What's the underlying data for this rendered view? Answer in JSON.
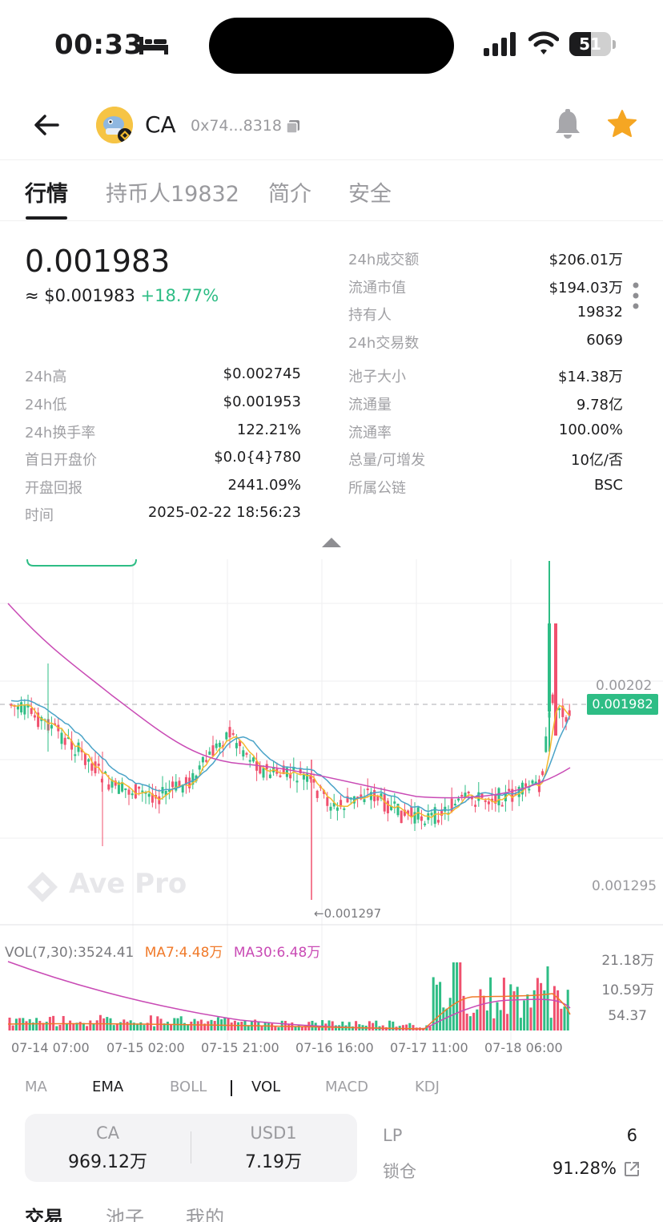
{
  "status_bar": {
    "time": "00:33",
    "battery": "51",
    "battery_fraction": 0.51
  },
  "header": {
    "symbol": "CA",
    "address": "0x74...8318",
    "icons": [
      "back-arrow-icon",
      "token-avatar",
      "copy-icon",
      "bell-icon",
      "star-icon"
    ],
    "star_color": "#f5a623"
  },
  "tabs": [
    "行情",
    "持币人19832",
    "简介",
    "安全"
  ],
  "price": {
    "main": "0.001983",
    "usd": "≈ $0.001983",
    "change": "+18.77%"
  },
  "stats_top_right": [
    {
      "label": "24h成交额",
      "value": "$206.01万"
    },
    {
      "label": "流通市值",
      "value": "$194.03万"
    },
    {
      "label": "持有人",
      "value": "19832"
    },
    {
      "label": "24h交易数",
      "value": "6069"
    }
  ],
  "stats_left": [
    {
      "label": "24h高",
      "value": "$0.002745"
    },
    {
      "label": "24h低",
      "value": "$0.001953"
    },
    {
      "label": "24h换手率",
      "value": "122.21%"
    },
    {
      "label": "首日开盘价",
      "value": "$0.0{4}780"
    },
    {
      "label": "开盘回报",
      "value": "2441.09%"
    },
    {
      "label": "时间",
      "value": "2025-02-22 18:56:23"
    }
  ],
  "stats_right": [
    {
      "label": "池子大小",
      "value": "$14.38万"
    },
    {
      "label": "流通量",
      "value": "9.78亿"
    },
    {
      "label": "流通率",
      "value": "100.00%"
    },
    {
      "label": "总量/可增发",
      "value": "10亿/否"
    },
    {
      "label": "所属公链",
      "value": "BSC"
    }
  ],
  "chart": {
    "watermark": "Ave Pro",
    "current_price_tag": "0.001982",
    "y_labels": {
      "upper": "0.00202",
      "lower": "0.001295"
    },
    "low_label": "←0.001297",
    "up_color": "#2ebd85",
    "down_color": "#f0506e"
  },
  "volume": {
    "legend_main": "VOL(7,30):3524.41",
    "legend_ma7": "MA7:4.48万",
    "legend_ma30": "MA30:6.48万",
    "axis": [
      "21.18万",
      "10.59万",
      "54.37"
    ]
  },
  "x_axis": [
    "07-14 07:00",
    "07-15 02:00",
    "07-15 21:00",
    "07-16 16:00",
    "07-17 11:00",
    "07-18 06:00"
  ],
  "indicators": [
    "MA",
    "EMA",
    "BOLL",
    "VOL",
    "MACD",
    "KDJ"
  ],
  "pool": {
    "token_a": "CA",
    "amount_a": "969.12万",
    "token_b": "USD1",
    "amount_b": "7.19万",
    "lp_label": "LP",
    "lp_value": "6",
    "lock_label": "锁仓",
    "lock_value": "91.28%"
  },
  "bottom_tabs": [
    "交易",
    "池子",
    "我的"
  ]
}
